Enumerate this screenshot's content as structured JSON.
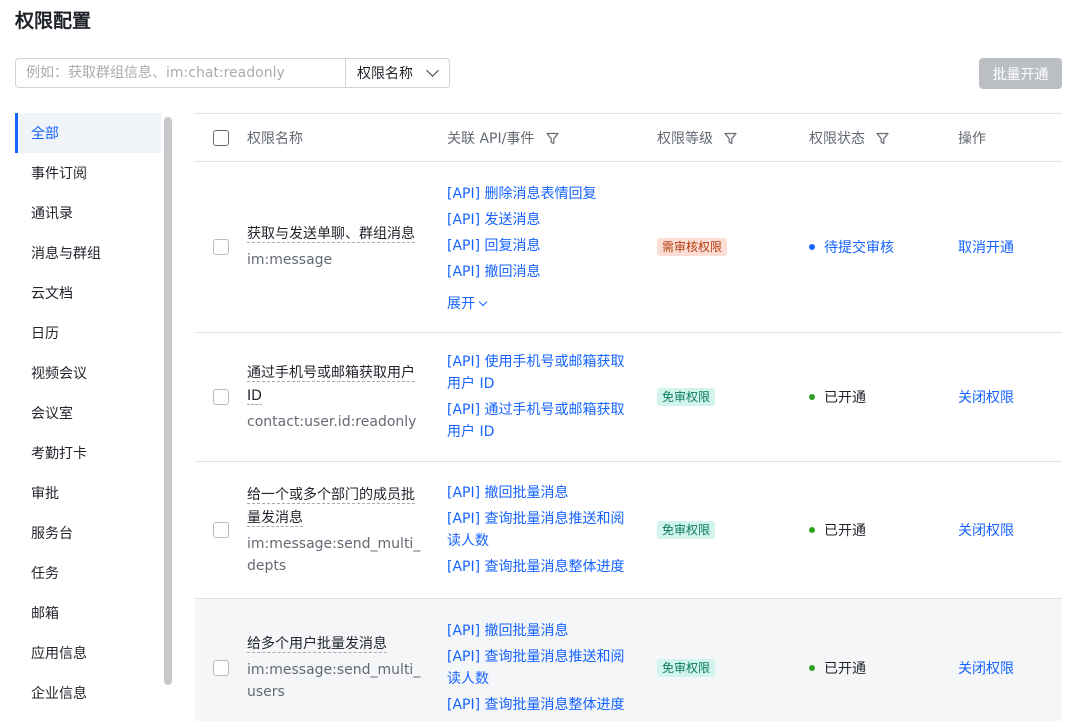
{
  "page_title": "权限配置",
  "search": {
    "placeholder": "例如：获取群组信息、im:chat:readonly",
    "select_label": "权限名称"
  },
  "batch_button": "批量开通",
  "sidebar": {
    "items": [
      {
        "label": "全部",
        "active": true
      },
      {
        "label": "事件订阅"
      },
      {
        "label": "通讯录"
      },
      {
        "label": "消息与群组"
      },
      {
        "label": "云文档"
      },
      {
        "label": "日历"
      },
      {
        "label": "视频会议"
      },
      {
        "label": "会议室"
      },
      {
        "label": "考勤打卡"
      },
      {
        "label": "审批"
      },
      {
        "label": "服务台"
      },
      {
        "label": "任务"
      },
      {
        "label": "邮箱"
      },
      {
        "label": "应用信息"
      },
      {
        "label": "企业信息"
      }
    ]
  },
  "table": {
    "headers": {
      "name": "权限名称",
      "api": "关联 API/事件",
      "level": "权限等级",
      "status": "权限状态",
      "action": "操作"
    },
    "rows": [
      {
        "name": "获取与发送单聊、群组消息",
        "code": "im:message",
        "apis": [
          "[API] 删除消息表情回复",
          "[API] 发送消息",
          "[API] 回复消息",
          "[API] 撤回消息"
        ],
        "expand": "展开",
        "level": "需审核权限",
        "status": "待提交审核",
        "action": "取消开通"
      },
      {
        "name": "通过手机号或邮箱获取用户 ID",
        "code": "contact:user.id:readonly",
        "apis": [
          "[API] 使用手机号或邮箱获取用户 ID",
          "[API] 通过手机号或邮箱获取用户 ID"
        ],
        "level": "免审权限",
        "status": "已开通",
        "action": "关闭权限"
      },
      {
        "name": "给一个或多个部门的成员批量发消息",
        "code": "im:message:send_multi_depts",
        "apis": [
          "[API] 撤回批量消息",
          "[API] 查询批量消息推送和阅读人数",
          "[API] 查询批量消息整体进度"
        ],
        "level": "免审权限",
        "status": "已开通",
        "action": "关闭权限"
      },
      {
        "name": "给多个用户批量发消息",
        "code": "im:message:send_multi_users",
        "apis": [
          "[API] 撤回批量消息",
          "[API] 查询批量消息推送和阅读人数",
          "[API] 查询批量消息整体进度"
        ],
        "level": "免审权限",
        "status": "已开通",
        "action": "关闭权限"
      }
    ]
  },
  "colors": {
    "accent": "#1664ff",
    "status_open": "#2ea121",
    "badge_review_bg": "#fdded6",
    "badge_free_bg": "#d1f5ec"
  }
}
